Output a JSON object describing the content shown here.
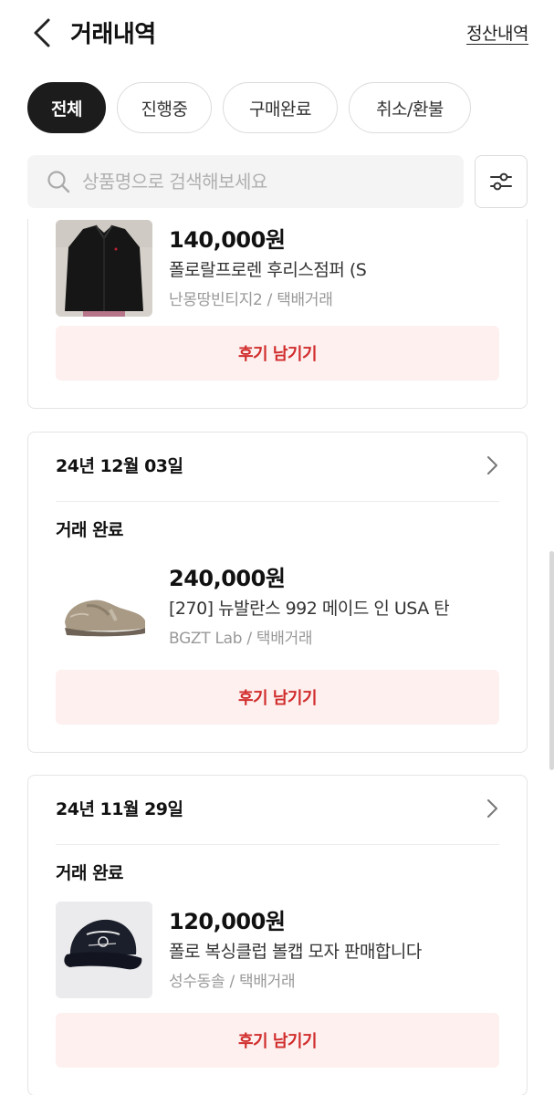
{
  "header": {
    "title": "거래내역",
    "settle_link": "정산내역"
  },
  "filters": [
    {
      "label": "전체",
      "active": true
    },
    {
      "label": "진행중",
      "active": false
    },
    {
      "label": "구매완료",
      "active": false
    },
    {
      "label": "취소/환불",
      "active": false
    }
  ],
  "search": {
    "placeholder": "상품명으로 검색해보세요",
    "value": ""
  },
  "orders": [
    {
      "date": "",
      "status": "",
      "price": "140,000원",
      "name": "폴로랄프로렌 후리스점퍼 (S",
      "meta": "난몽땅빈티지2 / 택배거래",
      "review_label": "후기 남기기",
      "thumb_icon": "fleece-jacket-photo"
    },
    {
      "date": "24년 12월 03일",
      "status": "거래 완료",
      "price": "240,000원",
      "name": "[270] 뉴발란스 992 메이드 인 USA 탄",
      "meta": "BGZT Lab / 택배거래",
      "review_label": "후기 남기기",
      "thumb_icon": "sneaker-photo"
    },
    {
      "date": "24년 11월 29일",
      "status": "거래 완료",
      "price": "120,000원",
      "name": "폴로 복싱클럽 볼캡 모자 판매합니다",
      "meta": "성수동솔 / 택배거래",
      "review_label": "후기 남기기",
      "thumb_icon": "cap-photo"
    }
  ],
  "colors": {
    "accent": "#d12c2c",
    "review_bg": "#fdf0ef",
    "active_chip": "#1c1c1c"
  }
}
